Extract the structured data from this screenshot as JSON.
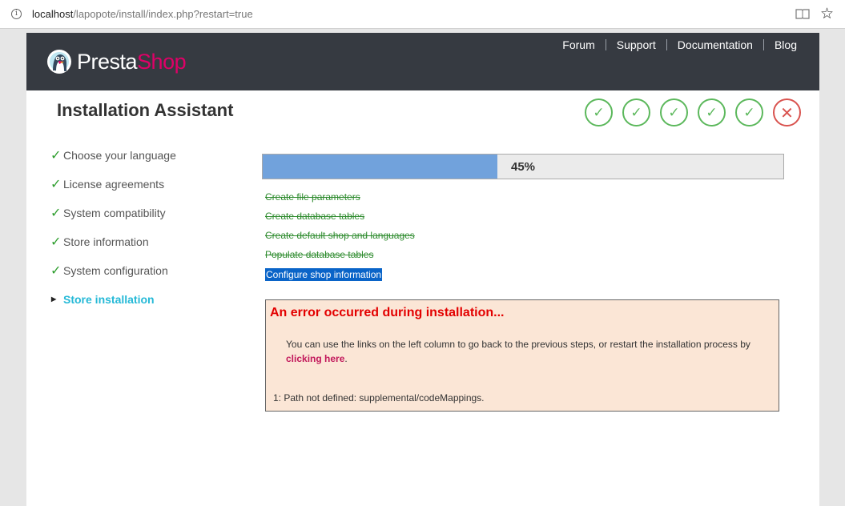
{
  "browser": {
    "url_host": "localhost",
    "url_path": "/lapopote/install/index.php?restart=true"
  },
  "header": {
    "logo_part1": "Presta",
    "logo_part2": "Shop",
    "nav": [
      "Forum",
      "Support",
      "Documentation",
      "Blog"
    ]
  },
  "page_title": "Installation Assistant",
  "step_status": [
    "done",
    "done",
    "done",
    "done",
    "done",
    "error"
  ],
  "sidebar": {
    "items": [
      {
        "label": "Choose your language",
        "state": "done"
      },
      {
        "label": "License agreements",
        "state": "done"
      },
      {
        "label": "System compatibility",
        "state": "done"
      },
      {
        "label": "Store information",
        "state": "done"
      },
      {
        "label": "System configuration",
        "state": "done"
      },
      {
        "label": "Store installation",
        "state": "active"
      }
    ]
  },
  "progress": {
    "label": "45%",
    "value": 0.45
  },
  "tasks": [
    {
      "label": "Create file parameters",
      "done": true
    },
    {
      "label": "Create database tables",
      "done": true
    },
    {
      "label": "Create default shop and languages",
      "done": true
    },
    {
      "label": "Populate database tables",
      "done": true
    },
    {
      "label": "Configure shop information",
      "done": false
    }
  ],
  "error": {
    "title": "An error occurred during installation...",
    "message_before": "You can use the links on the left column to go back to the previous steps, or restart the installation process by ",
    "link": "clicking here",
    "message_after": ".",
    "detail": "1: Path not defined: supplemental/codeMappings."
  },
  "colors": {
    "header_bg": "#363a41",
    "brand_pink": "#df0067",
    "active_step": "#25b9d7",
    "success": "#5cb85c",
    "danger": "#d9534f",
    "progress_fill": "#71a2dc",
    "error_bg": "#fbe6d6"
  }
}
